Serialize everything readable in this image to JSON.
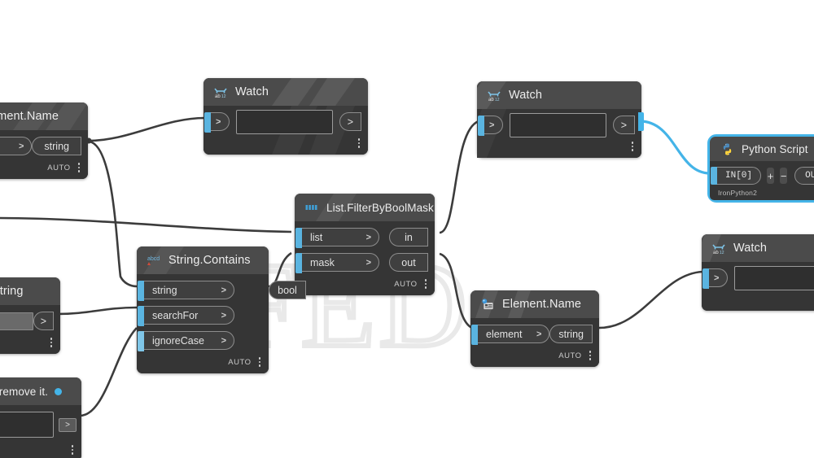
{
  "canvas": {
    "background_color": "#ffffff",
    "wire_color": "#3c3c3c",
    "selected_wire_color": "#44b4e8",
    "watermark_text": "GFED"
  },
  "nodes": [
    {
      "id": "element-name-left",
      "title": "ement.Name",
      "full_title": "Element.Name",
      "icon": "revit-element-icon",
      "inputs": [
        {
          "label": "",
          "caret": ">"
        }
      ],
      "outputs": [
        {
          "label": "string"
        }
      ],
      "footer": {
        "auto": "AUTO"
      }
    },
    {
      "id": "watch-top-left",
      "title": "Watch",
      "icon": "watch-ab12-icon",
      "inputs": [
        {
          "label": "",
          "caret": ">"
        }
      ],
      "outputs": [
        {
          "label": ">"
        }
      ],
      "footer": {
        "auto": ""
      }
    },
    {
      "id": "watch-top-right",
      "title": "Watch",
      "icon": "watch-ab12-icon",
      "inputs": [
        {
          "label": "",
          "caret": ">"
        }
      ],
      "outputs": [
        {
          "label": ">"
        }
      ],
      "footer": {
        "auto": ""
      }
    },
    {
      "id": "python-script",
      "title": "Python Script",
      "icon": "python-icon",
      "selected": true,
      "inputs": [
        {
          "label": "IN[0]"
        }
      ],
      "buttons": [
        {
          "label": "+"
        },
        {
          "label": "−"
        }
      ],
      "outputs": [
        {
          "label": "OUT"
        }
      ],
      "engine": "IronPython2"
    },
    {
      "id": "list-filter",
      "title": "List.FilterByBoolMask",
      "icon": "list-icon",
      "inputs": [
        {
          "label": "list",
          "caret": ">"
        },
        {
          "label": "mask",
          "caret": ">"
        }
      ],
      "outputs": [
        {
          "label": "in"
        },
        {
          "label": "out"
        }
      ],
      "footer": {
        "auto": "AUTO"
      }
    },
    {
      "id": "string-contains",
      "title": "String.Contains",
      "icon": "abcd-icon",
      "inputs": [
        {
          "label": "string",
          "caret": ">"
        },
        {
          "label": "searchFor",
          "caret": ">"
        },
        {
          "label": "ignoreCase",
          "caret": ">"
        }
      ],
      "outputs": [
        {
          "label": "bool"
        }
      ],
      "footer": {
        "auto": "AUTO"
      }
    },
    {
      "id": "string-node-left",
      "title": "String",
      "full_title": "String",
      "value": "",
      "outputs": [
        {
          "label": ">"
        }
      ],
      "footer": {
        "auto": ""
      }
    },
    {
      "id": "note-node-left",
      "title": "e to remove it.",
      "full_title": "...e to remove it.",
      "has_blue_dot": true,
      "value": "",
      "outputs": [
        {
          "label": ">"
        }
      ],
      "footer": {
        "auto": ""
      }
    },
    {
      "id": "element-name-right",
      "title": "Element.Name",
      "icon": "revit-element-icon",
      "inputs": [
        {
          "label": "element",
          "caret": ">"
        }
      ],
      "outputs": [
        {
          "label": "string"
        }
      ],
      "footer": {
        "auto": "AUTO"
      }
    },
    {
      "id": "watch-bottom-right",
      "title": "Watch",
      "icon": "watch-ab12-icon",
      "inputs": [
        {
          "label": "",
          "caret": ">"
        }
      ],
      "outputs": [],
      "footer": {
        "auto": ""
      }
    }
  ]
}
